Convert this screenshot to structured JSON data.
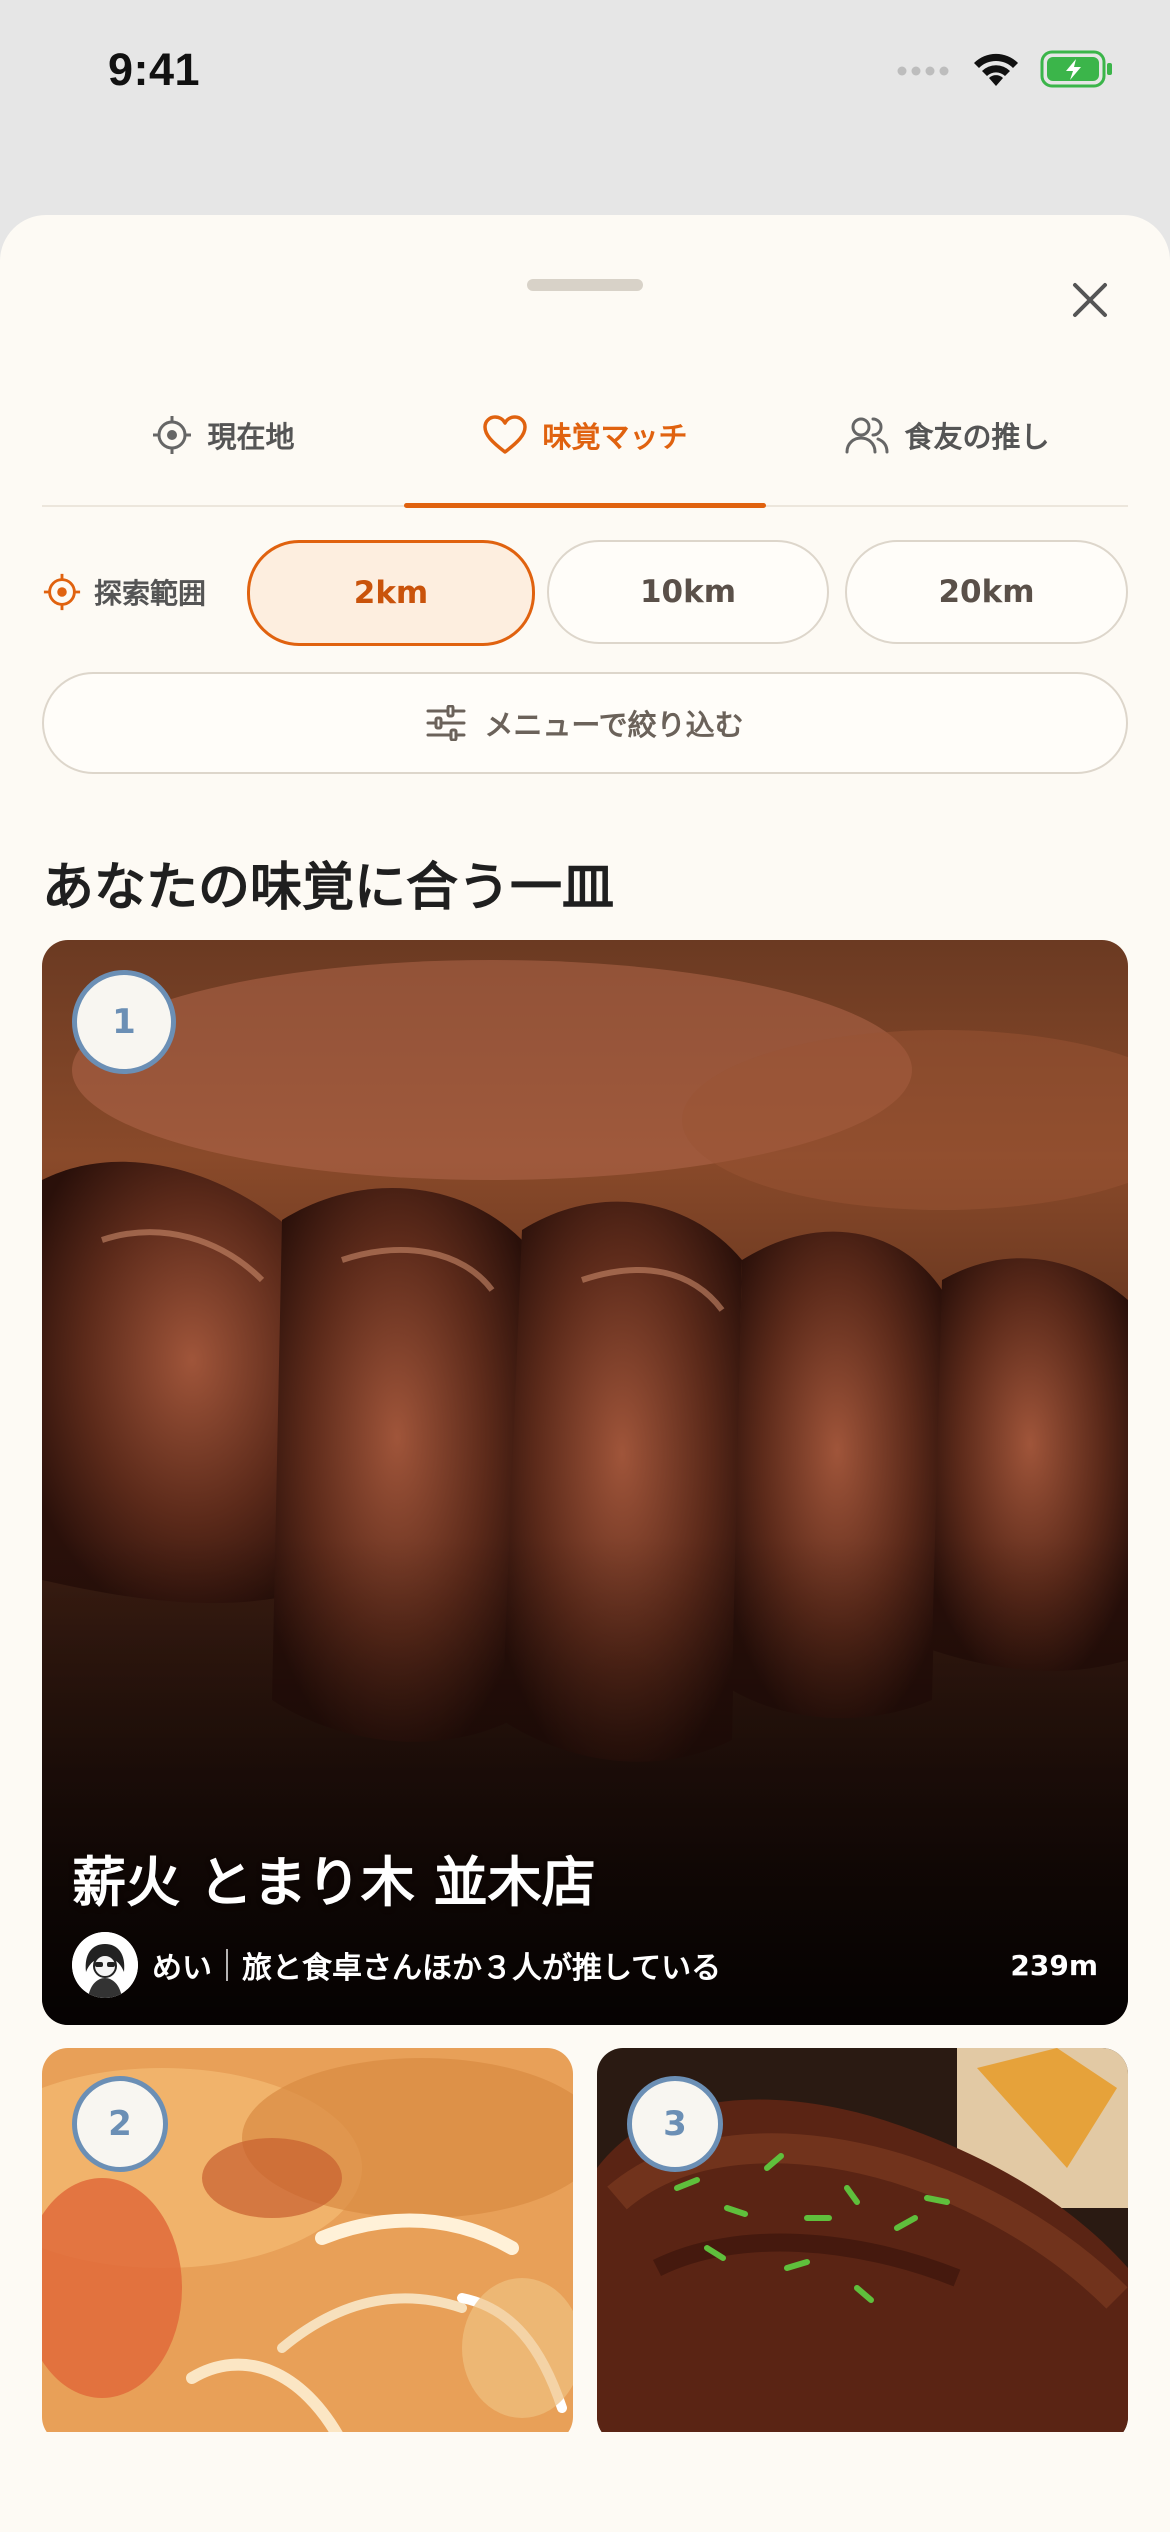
{
  "status_bar": {
    "time": "9:41"
  },
  "tabs": [
    {
      "label": "現在地",
      "icon": "target-icon",
      "active": false
    },
    {
      "label": "味覚マッチ",
      "icon": "heart-icon",
      "active": true
    },
    {
      "label": "食友の推し",
      "icon": "users-icon",
      "active": false
    }
  ],
  "range": {
    "label": "探索範囲",
    "options": [
      "2km",
      "10km",
      "20km"
    ],
    "selected": "2km"
  },
  "filter": {
    "label": "メニューで絞り込む"
  },
  "section": {
    "title": "あなたの味覚に合う一皿"
  },
  "cards": [
    {
      "rank": "1",
      "name": "薪火 とまり木 並木店",
      "user": "めい",
      "recommendation": "旅と食卓さんほか３人が推している",
      "distance": "239m"
    },
    {
      "rank": "2"
    },
    {
      "rank": "3"
    }
  ],
  "colors": {
    "accent": "#e0620f",
    "badge": "#6b8fb5",
    "sheet_bg": "#fdfaf4"
  }
}
